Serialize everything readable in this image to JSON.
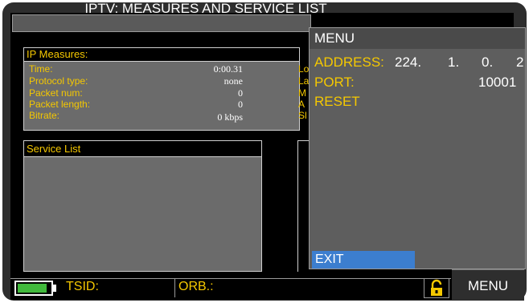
{
  "header": {
    "title": "IPTV: MEASURES AND SERVICE LIST"
  },
  "ip_measures": {
    "title": "IP Measures:",
    "rows": [
      {
        "label": "Time:",
        "value": "0:00.31"
      },
      {
        "label": "Protocol type:",
        "value": "none"
      },
      {
        "label": "Packet num:",
        "value": "0"
      },
      {
        "label": "Packet length:",
        "value": "0"
      },
      {
        "label": "Bitrate:",
        "value": "0 kbps"
      }
    ],
    "right_labels_partial": [
      "Lo",
      "La",
      "M",
      "A",
      "Sl"
    ]
  },
  "service_list": {
    "title": "Service List"
  },
  "menu": {
    "title": "MENU",
    "address_label": "ADDRESS:",
    "address_parts": [
      "224.",
      "1.",
      "0.",
      "2"
    ],
    "port_label": "PORT:",
    "port_value": "10001",
    "reset_label": "RESET",
    "exit_label": "EXIT"
  },
  "status_bar": {
    "battery_level": 0.9,
    "tsid_label": "TSID:",
    "orb_label": "ORB.:",
    "menu_button": "MENU"
  },
  "colors": {
    "label_yellow": "#f5c800",
    "selection_blue": "#3c7ecf",
    "battery_green": "#41b93c"
  }
}
